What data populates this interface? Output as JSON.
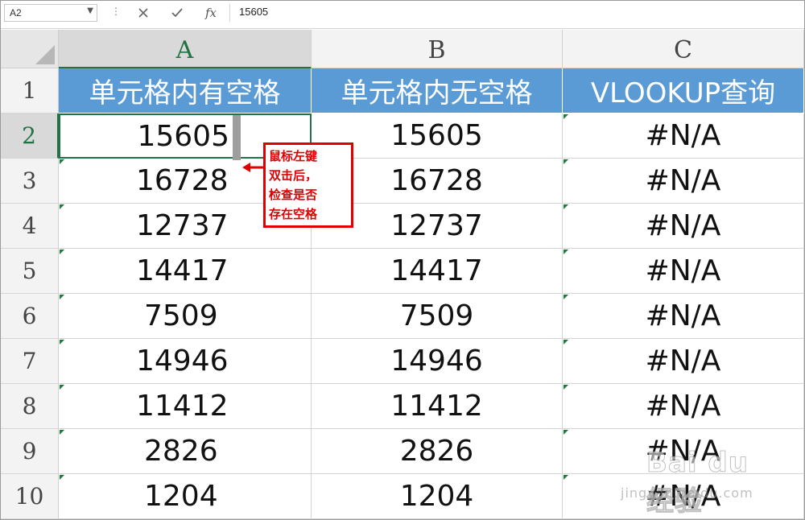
{
  "formula_bar": {
    "name_box": "A2",
    "cancel_icon": "close-icon",
    "enter_icon": "check-icon",
    "function_icon": "fx-icon",
    "function_label": "fx",
    "formula": "15605"
  },
  "sheet": {
    "columns": [
      "A",
      "B",
      "C"
    ],
    "selected_column": "A",
    "rows": [
      "1",
      "2",
      "3",
      "4",
      "5",
      "6",
      "7",
      "8",
      "9",
      "10"
    ],
    "selected_row": "2",
    "header_row": [
      "单元格内有空格",
      "单元格内无空格",
      "VLOOKUP查询"
    ],
    "data_rows": [
      [
        "15605",
        "15605",
        "#N/A"
      ],
      [
        "16728",
        "16728",
        "#N/A"
      ],
      [
        "12737",
        "12737",
        "#N/A"
      ],
      [
        "14417",
        "14417",
        "#N/A"
      ],
      [
        "7509",
        "7509",
        "#N/A"
      ],
      [
        "14946",
        "14946",
        "#N/A"
      ],
      [
        "11412",
        "11412",
        "#N/A"
      ],
      [
        "2826",
        "2826",
        "#N/A"
      ],
      [
        "1204",
        "1204",
        "#N/A"
      ]
    ],
    "header_fill": "#5b9bd5",
    "selection_color": "#217346"
  },
  "annotation": {
    "lines": [
      "鼠标左键",
      "双击后，",
      "检查是否",
      "存在空格"
    ],
    "color": "#e00000"
  },
  "watermark": {
    "brand": "Bai du 经验",
    "url": "jingyan.baidu.com"
  }
}
